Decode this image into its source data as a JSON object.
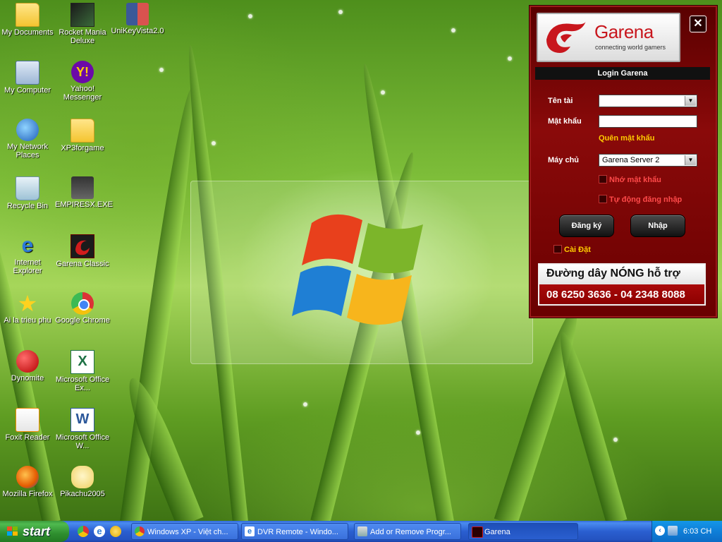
{
  "desktop_icons": [
    {
      "label": "My Documents",
      "icon": "my-documents-icon"
    },
    {
      "label": "My Computer",
      "icon": "my-computer-icon"
    },
    {
      "label": "My Network Places",
      "icon": "network-places-icon"
    },
    {
      "label": "Recycle Bin",
      "icon": "recycle-bin-icon"
    },
    {
      "label": "Internet Explorer",
      "icon": "internet-explorer-icon"
    },
    {
      "label": "Ai la trieu phu",
      "icon": "star-icon"
    },
    {
      "label": "Dynomite",
      "icon": "dynomite-icon"
    },
    {
      "label": "Foxit Reader",
      "icon": "foxit-reader-icon"
    },
    {
      "label": "Mozilla Firefox",
      "icon": "firefox-icon"
    },
    {
      "label": "Rocket Mania Deluxe",
      "icon": "rocket-mania-icon"
    },
    {
      "label": "Yahoo! Messenger",
      "icon": "yahoo-messenger-icon"
    },
    {
      "label": "XP3forgame",
      "icon": "folder-icon"
    },
    {
      "label": "EMPIRESX.EXE",
      "icon": "empires-icon"
    },
    {
      "label": "Garena Classic",
      "icon": "garena-classic-icon"
    },
    {
      "label": "Google Chrome",
      "icon": "chrome-icon"
    },
    {
      "label": "Microsoft Office Ex...",
      "icon": "excel-icon"
    },
    {
      "label": "Microsoft Office W...",
      "icon": "word-icon"
    },
    {
      "label": "Pikachu2005",
      "icon": "pikachu-icon"
    },
    {
      "label": "UniKeyVista2.0",
      "icon": "unikey-icon"
    }
  ],
  "garena": {
    "brand": "Garena",
    "tagline": "connecting world gamers",
    "close_label": "✕",
    "title": "Login Garena",
    "username_label": "Tên tài",
    "username_value": "",
    "password_label": "Mật khẩu",
    "password_value": "",
    "forgot_password": "Quên mật khẩu",
    "server_label": "Máy chủ",
    "server_value": "Garena Server 2",
    "remember_password": "Nhớ mật khẩu",
    "auto_login": "Tự động đăng nhập",
    "register_button": "Đăng ký",
    "login_button": "Nhập",
    "settings_label": "Cài Đặt",
    "hotline_title": "Đường dây NÓNG hỗ trợ",
    "hotline_numbers": "08 6250 3636 - 04 2348 8088"
  },
  "taskbar": {
    "start_label": "start",
    "tasks": [
      {
        "label": "Windows XP - Việt ch...",
        "icon": "chrome-icon"
      },
      {
        "label": "DVR Remote - Windo...",
        "icon": "internet-explorer-icon"
      },
      {
        "label": "Add or Remove Progr...",
        "icon": "control-panel-icon"
      },
      {
        "label": "Garena",
        "icon": "garena-icon"
      }
    ],
    "clock": "6:03 CH"
  },
  "colors": {
    "garena_red": "#c8161d",
    "taskbar_blue": "#2453c0",
    "start_green": "#2f8f2f"
  }
}
